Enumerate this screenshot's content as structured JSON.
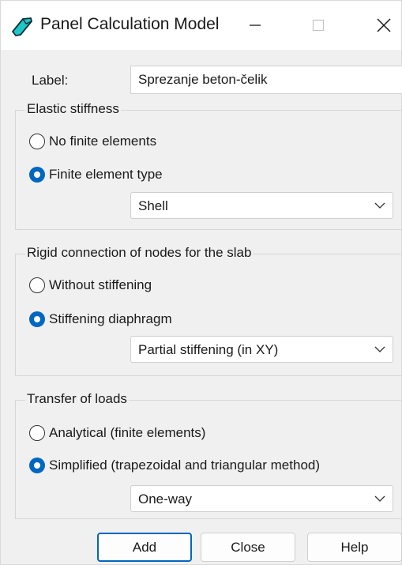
{
  "window": {
    "title": "Panel Calculation Model",
    "controls": [
      "minimize",
      "maximize",
      "close"
    ]
  },
  "label": {
    "caption": "Label:",
    "value": "Sprezanje beton-čelik"
  },
  "elastic_stiffness": {
    "title": "Elastic stiffness",
    "options": [
      {
        "label": "No finite elements",
        "checked": false
      },
      {
        "label": "Finite element type",
        "checked": true
      }
    ],
    "dropdown_value": "Shell"
  },
  "rigid_connection": {
    "title": "Rigid connection of nodes for the slab",
    "options": [
      {
        "label": "Without stiffening",
        "checked": false
      },
      {
        "label": "Stiffening diaphragm",
        "checked": true
      }
    ],
    "dropdown_value": "Partial stiffening (in XY)"
  },
  "transfer_of_loads": {
    "title": "Transfer of loads",
    "options": [
      {
        "label": "Analytical (finite elements)",
        "checked": false
      },
      {
        "label": "Simplified (trapezoidal and triangular method)",
        "checked": true
      }
    ],
    "dropdown_value": "One-way"
  },
  "buttons": {
    "add": "Add",
    "close": "Close",
    "help": "Help"
  },
  "colors": {
    "accent": "#0067c0",
    "dialog_background": "#f0f0f0",
    "app_icon": "#1ec8c8"
  }
}
